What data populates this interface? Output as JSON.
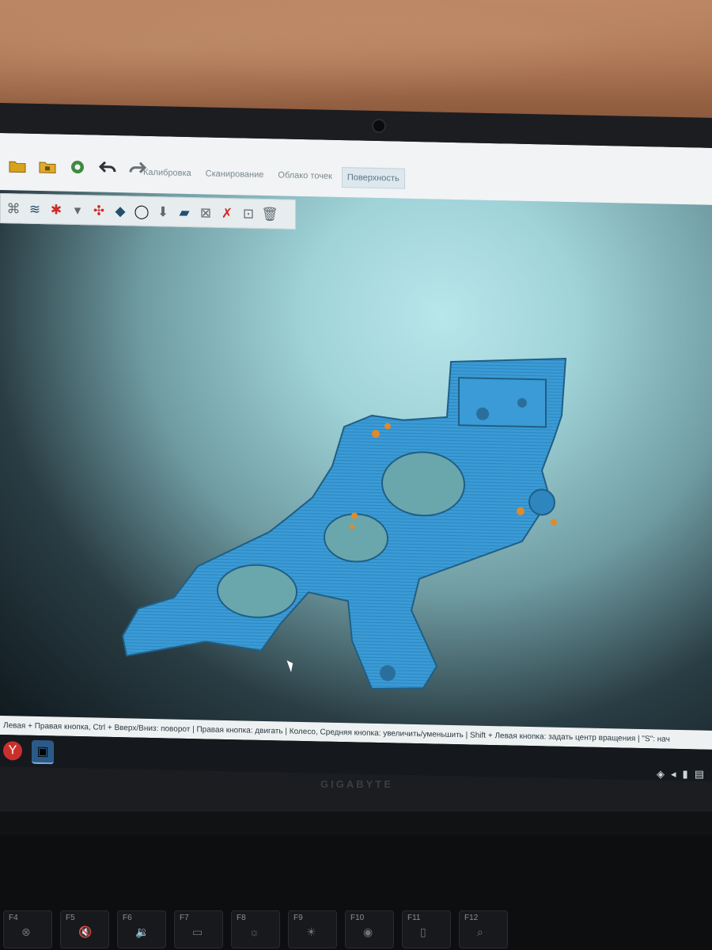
{
  "menu": {
    "tabs": [
      "Калибровка",
      "Сканирование",
      "Облако точек",
      "Поверхность"
    ],
    "active_tab": "Поверхность"
  },
  "top_icons": [
    "folder-open-icon",
    "folder-save-icon",
    "settings-gear-icon",
    "undo-icon",
    "redo-icon"
  ],
  "toolbar_icons": [
    "mesh-tool-icon",
    "layers-icon",
    "select-icon",
    "dropdown-arrow-icon",
    "fill-holes-icon",
    "blue-shape-icon",
    "ring-icon",
    "arrow-down-icon",
    "plane-icon",
    "crossed-mesh-icon",
    "red-mesh-icon",
    "mesh-tool-2-icon",
    "trash-icon"
  ],
  "status_text": "Левая + Правая кнопка, Ctrl + Вверх/Вниз: поворот | Правая кнопка: двигать | Колесо, Средняя кнопка: увеличить/уменьшить | Shift + Левая кнопка: задать центр вращения | \"S\": нач",
  "taskbar": {
    "apps": [
      "yandex-browser-icon",
      "scanner-app-icon"
    ]
  },
  "tray_icons": [
    "network-icon",
    "volume-icon",
    "battery-icon",
    "notification-icon"
  ],
  "laptop_brand": "GIGABYTE",
  "fkeys": [
    {
      "label": "F4",
      "symbol": "⊗"
    },
    {
      "label": "F5",
      "symbol": "🔇"
    },
    {
      "label": "F6",
      "symbol": "🔉"
    },
    {
      "label": "F7",
      "symbol": "▭"
    },
    {
      "label": "F8",
      "symbol": "☼"
    },
    {
      "label": "F9",
      "symbol": "☀"
    },
    {
      "label": "F10",
      "symbol": "◉"
    },
    {
      "label": "F11",
      "symbol": "▯"
    },
    {
      "label": "F12",
      "symbol": "⌕"
    }
  ]
}
